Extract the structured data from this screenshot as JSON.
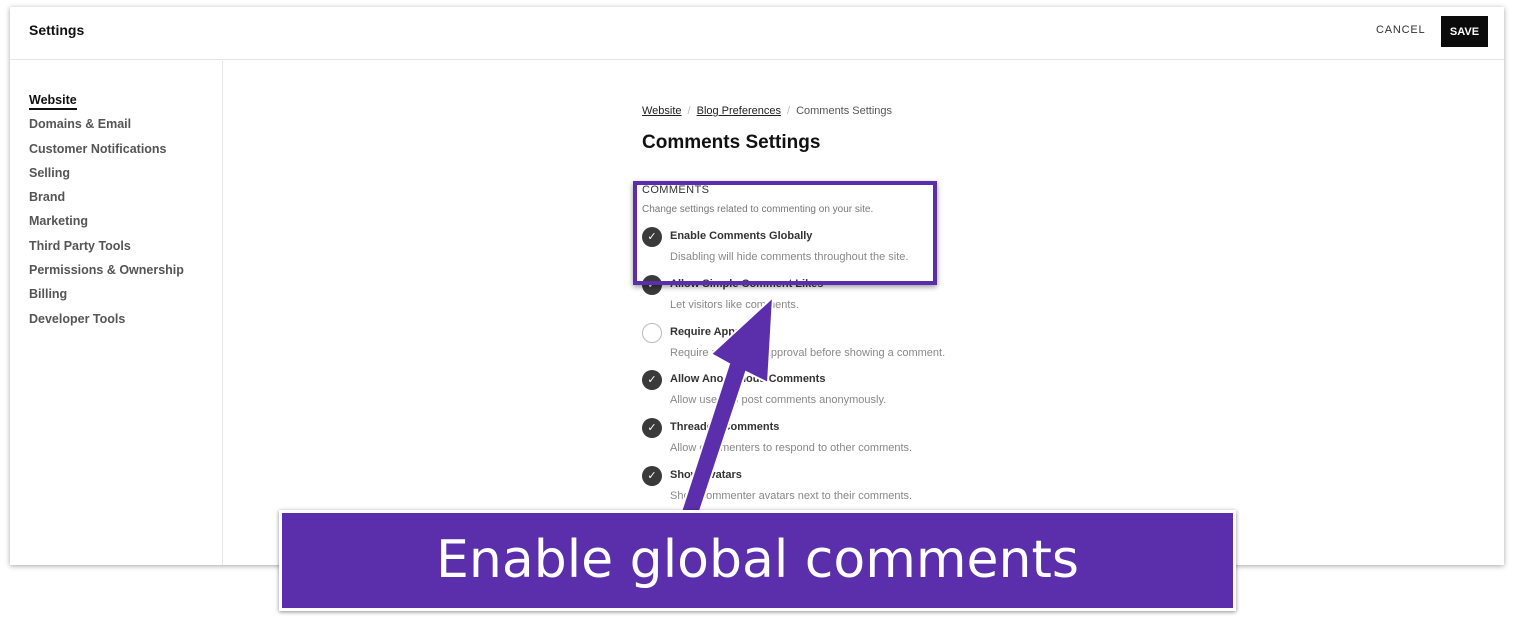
{
  "header": {
    "title": "Settings",
    "cancel_label": "CANCEL",
    "save_label": "SAVE"
  },
  "sidebar": {
    "items": [
      {
        "label": "Website",
        "active": true
      },
      {
        "label": "Domains & Email"
      },
      {
        "label": "Customer Notifications"
      },
      {
        "label": "Selling"
      },
      {
        "label": "Brand"
      },
      {
        "label": "Marketing"
      },
      {
        "label": "Third Party Tools"
      },
      {
        "label": "Permissions & Ownership"
      },
      {
        "label": "Billing"
      },
      {
        "label": "Developer Tools"
      }
    ]
  },
  "breadcrumb": {
    "items": [
      "Website",
      "Blog Preferences"
    ],
    "current": "Comments Settings"
  },
  "page_title": "Comments Settings",
  "section": {
    "title": "COMMENTS",
    "description": "Change settings related to commenting on your site.",
    "options": [
      {
        "label": "Enable Comments Globally",
        "description": "Disabling will hide comments throughout the site.",
        "checked": true
      },
      {
        "label": "Allow Simple Comment Likes",
        "description": "Let visitors like comments.",
        "checked": true
      },
      {
        "label": "Require Approval",
        "description": "Require moderator approval before showing a comment.",
        "checked": false
      },
      {
        "label": "Allow Anonymous Comments",
        "description": "Allow users to post comments anonymously.",
        "checked": true
      },
      {
        "label": "Threaded Comments",
        "description": "Allow commenters to respond to other comments.",
        "checked": true
      },
      {
        "label": "Show Avatars",
        "description": "Show commenter avatars next to their comments.",
        "checked": true
      }
    ]
  },
  "annotation": {
    "caption": "Enable global comments",
    "color": "#5b2fab"
  }
}
